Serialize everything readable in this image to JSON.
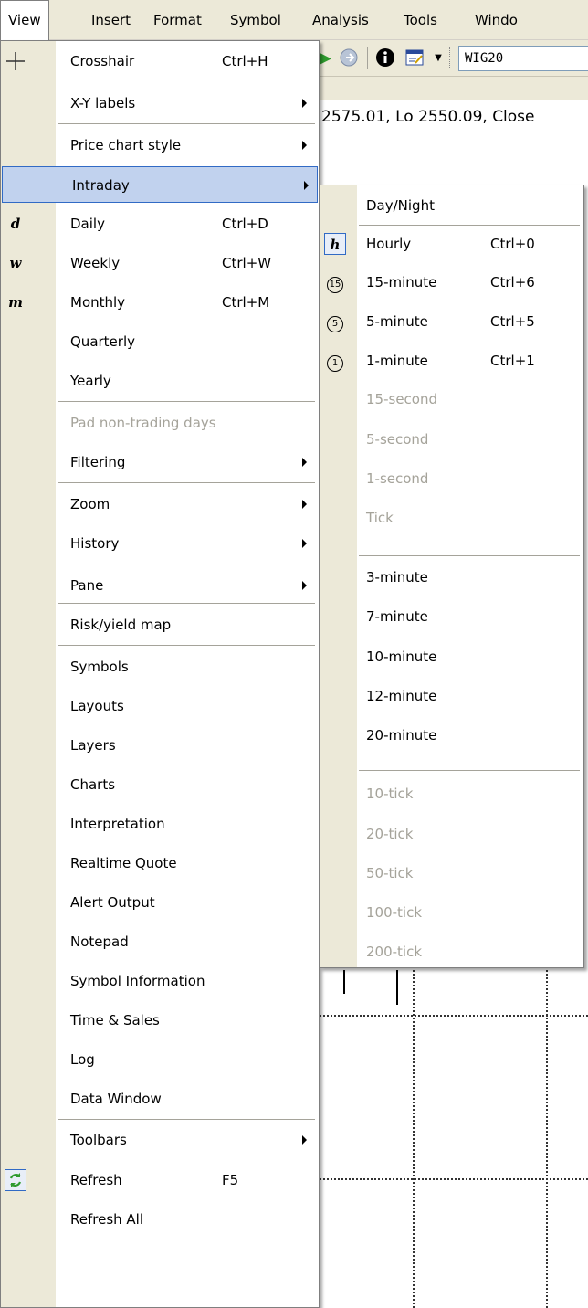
{
  "menubar": {
    "items": [
      "View",
      "Insert",
      "Format",
      "Symbol",
      "Analysis",
      "Tools",
      "Windo"
    ]
  },
  "toolbar": {
    "symbol": "WIG20"
  },
  "quote_text": "2575.01, Lo 2550.09, Close",
  "view_menu": {
    "items": [
      {
        "label": "Crosshair",
        "shortcut": "Ctrl+H",
        "icon": "crosshair-icon"
      },
      {
        "label": "X-Y labels",
        "submenu": true
      },
      {
        "label": "Price chart style",
        "submenu": true
      },
      {
        "label": "Intraday",
        "submenu": true,
        "highlighted": true
      },
      {
        "label": "Daily",
        "shortcut": "Ctrl+D",
        "icon_text": "d"
      },
      {
        "label": "Weekly",
        "shortcut": "Ctrl+W",
        "icon_text": "w"
      },
      {
        "label": "Monthly",
        "shortcut": "Ctrl+M",
        "icon_text": "m"
      },
      {
        "label": "Quarterly"
      },
      {
        "label": "Yearly"
      },
      {
        "label": "Pad non-trading days",
        "disabled": true
      },
      {
        "label": "Filtering",
        "submenu": true
      },
      {
        "label": "Zoom",
        "submenu": true
      },
      {
        "label": "History",
        "submenu": true
      },
      {
        "label": "Pane",
        "submenu": true
      },
      {
        "label": "Risk/yield map"
      },
      {
        "label": "Symbols"
      },
      {
        "label": "Layouts"
      },
      {
        "label": "Layers"
      },
      {
        "label": "Charts"
      },
      {
        "label": "Interpretation"
      },
      {
        "label": "Realtime Quote"
      },
      {
        "label": "Alert Output"
      },
      {
        "label": "Notepad"
      },
      {
        "label": "Symbol Information"
      },
      {
        "label": "Time & Sales"
      },
      {
        "label": "Log"
      },
      {
        "label": "Data Window"
      },
      {
        "label": "Toolbars",
        "submenu": true
      },
      {
        "label": "Refresh",
        "shortcut": "F5",
        "icon": "refresh-icon"
      },
      {
        "label": "Refresh All"
      }
    ]
  },
  "intraday_menu": {
    "items": [
      {
        "label": "Day/Night"
      },
      {
        "label": "Hourly",
        "shortcut": "Ctrl+0",
        "icon_text": "h"
      },
      {
        "label": "15-minute",
        "shortcut": "Ctrl+6",
        "icon_text": "15"
      },
      {
        "label": "5-minute",
        "shortcut": "Ctrl+5",
        "icon_text": "5"
      },
      {
        "label": "1-minute",
        "shortcut": "Ctrl+1",
        "icon_text": "1"
      },
      {
        "label": "15-second",
        "disabled": true
      },
      {
        "label": "5-second",
        "disabled": true
      },
      {
        "label": "1-second",
        "disabled": true
      },
      {
        "label": "Tick",
        "disabled": true
      },
      {
        "label": "3-minute"
      },
      {
        "label": "7-minute"
      },
      {
        "label": "10-minute"
      },
      {
        "label": "12-minute"
      },
      {
        "label": "20-minute"
      },
      {
        "label": "10-tick",
        "disabled": true
      },
      {
        "label": "20-tick",
        "disabled": true
      },
      {
        "label": "50-tick",
        "disabled": true
      },
      {
        "label": "100-tick",
        "disabled": true
      },
      {
        "label": "200-tick",
        "disabled": true
      }
    ]
  },
  "colors": {
    "menu_highlight": "#c1d2ee",
    "menu_highlight_border": "#316ac5",
    "disabled_text": "#a5a39a",
    "menubar_bg": "#ece9d8"
  }
}
